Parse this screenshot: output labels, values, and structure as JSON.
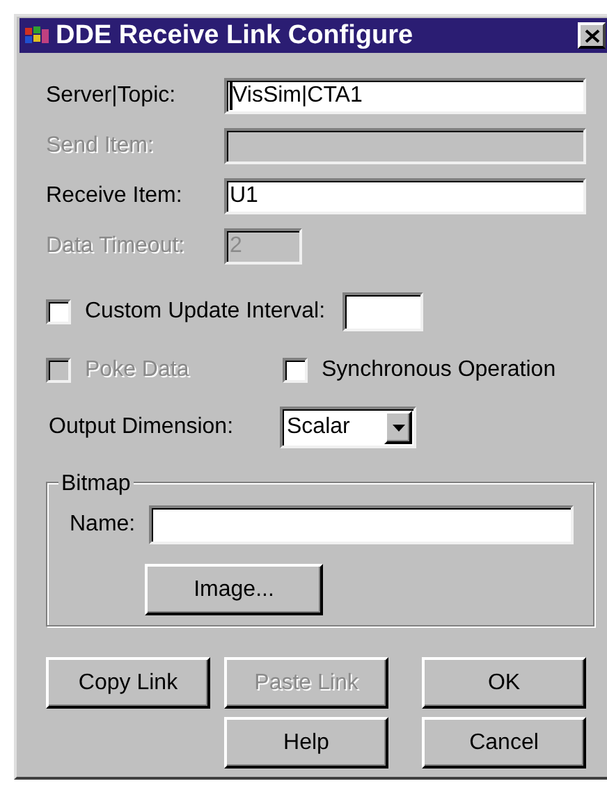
{
  "window": {
    "title": "DDE Receive Link Configure"
  },
  "fields": [
    {
      "label": "Server|Topic:",
      "value": "VisSim|CTA1",
      "disabled": false,
      "focused": true
    },
    {
      "label": "Send Item:",
      "disabled": true,
      "focused": false
    },
    {
      "label": "Receive Item:",
      "value": "U1",
      "disabled": false,
      "focused": false
    },
    {
      "label": "Data Timeout:",
      "value": "2",
      "disabled": true,
      "focused": false
    }
  ],
  "custom_update": {
    "label": "Custom Update Interval:",
    "checked": false,
    "disabled": false
  },
  "poke_data": {
    "label": "Poke Data",
    "checked": false,
    "disabled": true
  },
  "synchronous": {
    "label": "Synchronous Operation",
    "checked": false,
    "disabled": false
  },
  "output_dimension": {
    "label": "Output Dimension:",
    "value": "Scalar"
  },
  "bitmap": {
    "title": "Bitmap",
    "name_label": "Name:",
    "image_button": {
      "label": "Image...",
      "disabled": false
    }
  },
  "buttons": [
    {
      "label": "Copy Link",
      "disabled": false
    },
    {
      "label": "Paste Link",
      "disabled": true
    },
    {
      "label": "OK",
      "disabled": false
    },
    {
      "label": "Help",
      "disabled": false
    },
    {
      "label": "Cancel",
      "disabled": false
    }
  ]
}
